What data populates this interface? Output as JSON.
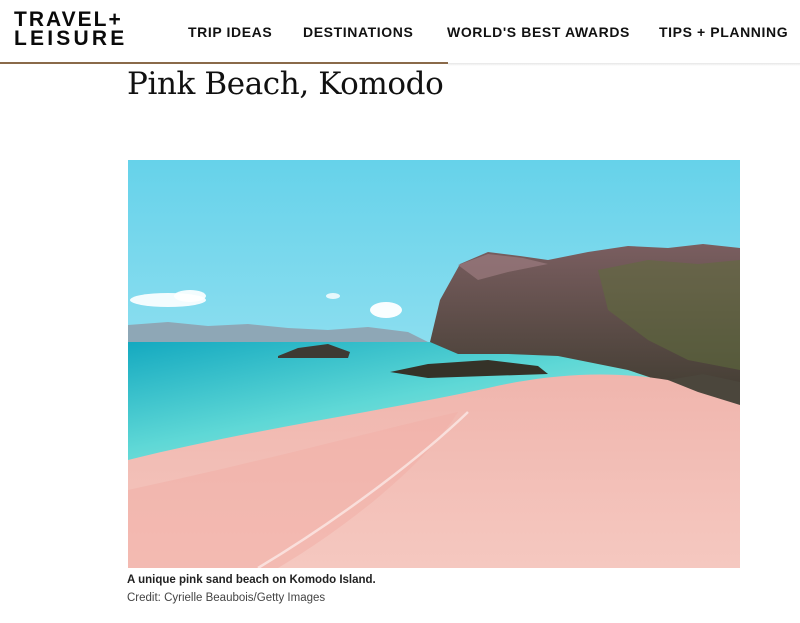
{
  "header": {
    "logo_line1": "TRAVEL+",
    "logo_line2": "LEISURE",
    "nav": [
      "TRIP IDEAS",
      "DESTINATIONS",
      "WORLD'S BEST AWARDS",
      "TIPS + PLANNING"
    ]
  },
  "article": {
    "title": "Pink Beach, Komodo",
    "image": {
      "caption": "A unique pink sand beach on Komodo Island.",
      "credit": "Credit: Cyrielle Beaubois/Getty Images"
    }
  },
  "colors": {
    "accent_underline": "#8a6a4a",
    "sky": "#6fd3ea",
    "sea": "#3bc6cf",
    "sand": "#f2b6b0"
  }
}
